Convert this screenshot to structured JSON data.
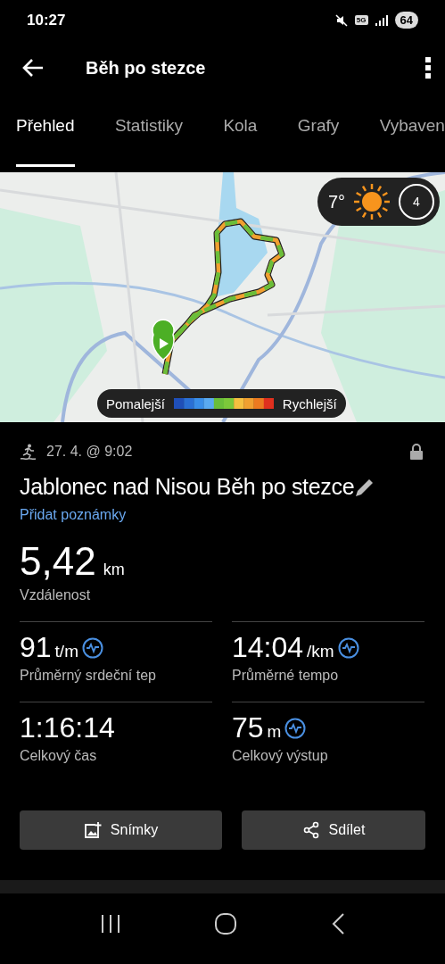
{
  "status_bar": {
    "time": "10:27",
    "network": "5G",
    "battery": "64"
  },
  "app_bar": {
    "title": "Běh po stezce"
  },
  "tabs": [
    {
      "label": "Přehled",
      "selected": true
    },
    {
      "label": "Statistiky",
      "selected": false
    },
    {
      "label": "Kola",
      "selected": false
    },
    {
      "label": "Grafy",
      "selected": false
    },
    {
      "label": "Vybaven",
      "selected": false
    }
  ],
  "map": {
    "weather": {
      "temperature": "7°",
      "wind": "4"
    },
    "legend": {
      "slow_label": "Pomalejší",
      "fast_label": "Rychlejší"
    }
  },
  "activity": {
    "date": "27. 4. @ 9:02",
    "title": "Jablonec nad Nisou Běh po stezce",
    "notes_link": "Přidat poznámky"
  },
  "distance": {
    "value": "5,42",
    "unit": "km",
    "label": "Vzdálenost"
  },
  "stats": [
    {
      "value": "91",
      "unit": "t/m",
      "label": "Průměrný srdeční tep",
      "kind": "graph"
    },
    {
      "value": "14:04",
      "unit": "/km",
      "label": "Průměrné tempo",
      "kind": "graph"
    },
    {
      "value": "1:16:14",
      "label": "Celkový čas",
      "kind": "plain"
    },
    {
      "value": "75",
      "unit": "m",
      "label": "Celkový výstup",
      "kind": "graph"
    }
  ],
  "buttons": [
    {
      "label": "Snímky",
      "kind": "photos"
    },
    {
      "label": "Sdílet",
      "kind": "share"
    }
  ]
}
